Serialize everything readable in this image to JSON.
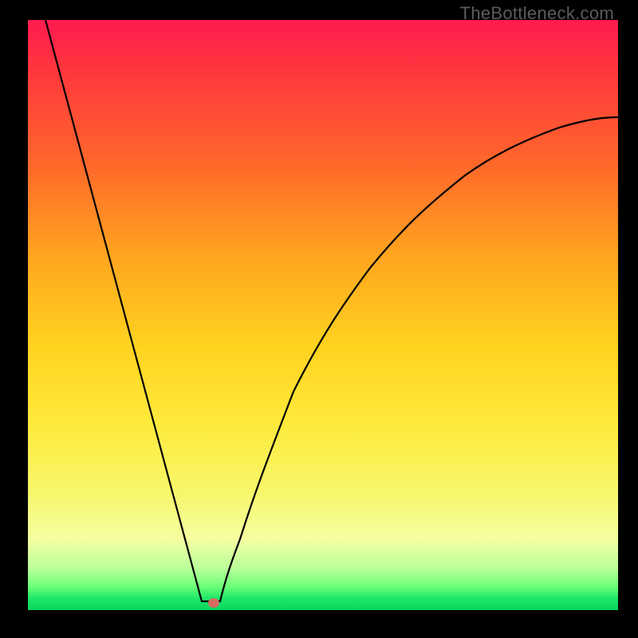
{
  "watermark": "TheBottleneck.com",
  "chart_data": {
    "type": "line",
    "title": "",
    "xlabel": "",
    "ylabel": "",
    "xlim": [
      0,
      1
    ],
    "ylim": [
      0,
      1
    ],
    "series": [
      {
        "name": "left-branch",
        "x": [
          0.03,
          0.295
        ],
        "y": [
          1.0,
          0.015
        ]
      },
      {
        "name": "plateau",
        "x": [
          0.295,
          0.325
        ],
        "y": [
          0.015,
          0.015
        ]
      },
      {
        "name": "right-branch",
        "x": [
          0.325,
          0.36,
          0.4,
          0.45,
          0.5,
          0.58,
          0.66,
          0.74,
          0.82,
          0.9,
          1.0
        ],
        "y": [
          0.015,
          0.12,
          0.24,
          0.37,
          0.47,
          0.58,
          0.66,
          0.72,
          0.77,
          0.8,
          0.835
        ]
      }
    ],
    "marker": {
      "x": 0.315,
      "y": 0.012
    },
    "background_gradient": {
      "top": "#ff1a4f",
      "mid": "#ffd21f",
      "bottom": "#07d45e"
    }
  }
}
